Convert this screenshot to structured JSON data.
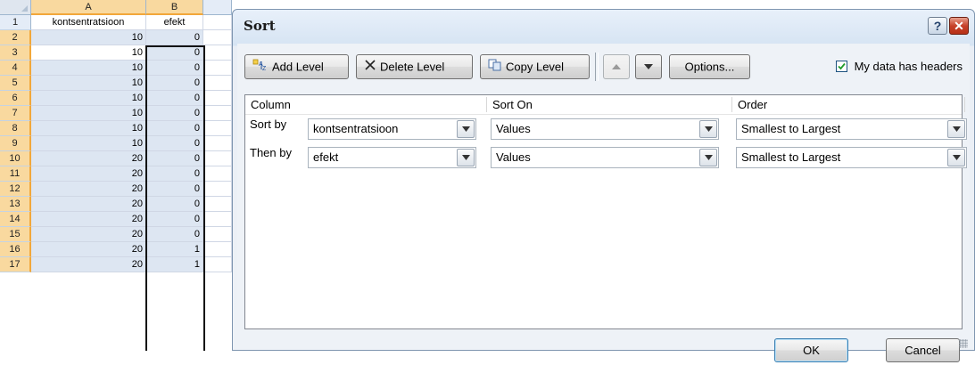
{
  "sheet": {
    "columns": [
      "A",
      "B"
    ],
    "rows": [
      {
        "num": "1",
        "a": "kontsentratsioon",
        "b": "efekt"
      },
      {
        "num": "2",
        "a": "10",
        "b": "0"
      },
      {
        "num": "3",
        "a": "10",
        "b": "0"
      },
      {
        "num": "4",
        "a": "10",
        "b": "0"
      },
      {
        "num": "5",
        "a": "10",
        "b": "0"
      },
      {
        "num": "6",
        "a": "10",
        "b": "0"
      },
      {
        "num": "7",
        "a": "10",
        "b": "0"
      },
      {
        "num": "8",
        "a": "10",
        "b": "0"
      },
      {
        "num": "9",
        "a": "10",
        "b": "0"
      },
      {
        "num": "10",
        "a": "20",
        "b": "0"
      },
      {
        "num": "11",
        "a": "20",
        "b": "0"
      },
      {
        "num": "12",
        "a": "20",
        "b": "0"
      },
      {
        "num": "13",
        "a": "20",
        "b": "0"
      },
      {
        "num": "14",
        "a": "20",
        "b": "0"
      },
      {
        "num": "15",
        "a": "20",
        "b": "0"
      },
      {
        "num": "16",
        "a": "20",
        "b": "1"
      },
      {
        "num": "17",
        "a": "20",
        "b": "1"
      }
    ]
  },
  "dialog": {
    "title": "Sort",
    "help_label": "?",
    "close_label": "✕",
    "toolbar": {
      "add_level": "Add Level",
      "delete_level": "Delete Level",
      "copy_level": "Copy Level",
      "options": "Options...",
      "my_data_has_headers": "My data has headers",
      "my_data_has_headers_checked": true
    },
    "grid": {
      "headers": {
        "column": "Column",
        "sort_on": "Sort On",
        "order": "Order"
      },
      "levels": [
        {
          "label": "Sort by",
          "column": "kontsentratsioon",
          "sort_on": "Values",
          "order": "Smallest to Largest"
        },
        {
          "label": "Then by",
          "column": "efekt",
          "sort_on": "Values",
          "order": "Smallest to Largest"
        }
      ]
    },
    "ok": "OK",
    "cancel": "Cancel"
  },
  "colors": {
    "selected_header": "#f9d99f",
    "selection_fill": "#dde6f2",
    "dialog_bg": "#eef2f7",
    "close_red": "#c7422a"
  }
}
